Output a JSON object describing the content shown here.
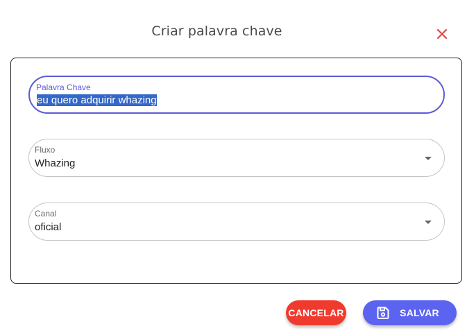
{
  "dialog": {
    "title": "Criar palavra chave",
    "close_icon": "close-icon"
  },
  "form": {
    "keyword": {
      "label": "Palavra Chave",
      "value": "eu quero adquirir whazing"
    },
    "flow": {
      "label": "Fluxo",
      "value": "Whazing"
    },
    "channel": {
      "label": "Canal",
      "value": "oficial"
    }
  },
  "actions": {
    "cancel_label": "CANCELAR",
    "save_label": "SALVAR",
    "save_icon": "save-icon"
  },
  "colors": {
    "accent": "#5b63f0",
    "danger": "#f03a2e",
    "close": "#e53935"
  }
}
